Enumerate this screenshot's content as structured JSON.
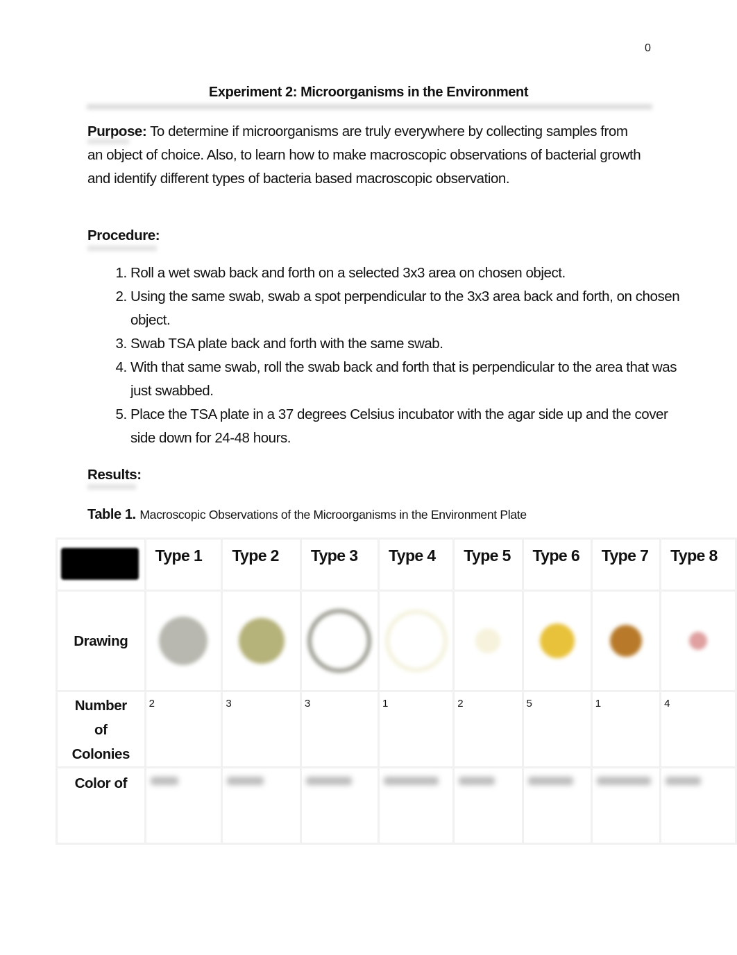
{
  "page_number": "0",
  "title": "Experiment 2: Microorganisms in the Environment",
  "purpose": {
    "label": "Purpose:",
    "text": " To determine if microorganisms are truly everywhere by collecting samples from an object of choice. Also, to learn how to make macroscopic observations of bacterial growth and identify different types of bacteria based macroscopic observation."
  },
  "procedure": {
    "label": "Procedure:",
    "steps": [
      "Roll a wet swab back and forth on a selected 3x3 area on chosen object.",
      "Using the same swab, swab a spot perpendicular to the 3x3 area back and forth, on chosen object.",
      " Swab TSA plate back and forth with the same swab.",
      "With that same swab, roll the swab back and forth that is perpendicular to the area that was just swabbed.",
      "Place the TSA plate in a 37 degrees Celsius incubator with the agar side up and the cover side down for 24-48 hours."
    ]
  },
  "results": {
    "label": "Results:",
    "table_label": "Table 1.",
    "table_caption": "Macroscopic Observations of the Microorganisms in the Environment Plate",
    "columns": [
      "Type 1",
      "Type 2",
      "Type 3",
      "Type 4",
      "Type 5",
      "Type 6",
      "Type 7",
      "Type 8"
    ],
    "row_labels": {
      "drawing": "Drawing",
      "number_1": "Number",
      "number_2": "of",
      "number_3": "Colonies",
      "color": "Color of"
    },
    "colony_counts": [
      "2",
      "3",
      "3",
      "1",
      "2",
      "5",
      "1",
      "4"
    ],
    "drawing_colors": [
      "#b8b8b0",
      "#b5b27a",
      "#9a9a90",
      "#f4f2dc",
      "#f6f2dc",
      "#e8c23a",
      "#b87a2a",
      "#e0a0a0"
    ]
  }
}
